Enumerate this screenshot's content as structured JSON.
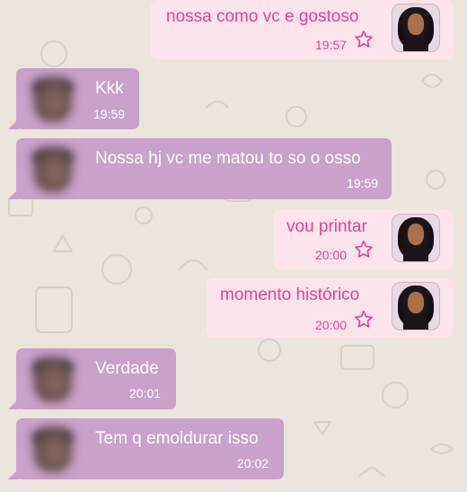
{
  "messages": [
    {
      "direction": "outgoing",
      "text": "nossa como vc e gostoso",
      "time": "19:57",
      "avatar_icon": "profile-photo-icon",
      "status_icon": "star-icon"
    },
    {
      "direction": "incoming",
      "text": "Kkk",
      "time": "19:59",
      "avatar_icon": "profile-photo-icon"
    },
    {
      "direction": "incoming",
      "text": "Nossa hj vc me matou to so o osso",
      "time": "19:59",
      "avatar_icon": "profile-photo-icon"
    },
    {
      "direction": "outgoing",
      "text": "vou printar",
      "time": "20:00",
      "avatar_icon": "profile-photo-icon",
      "status_icon": "star-icon"
    },
    {
      "direction": "outgoing",
      "text": "momento histórico",
      "time": "20:00",
      "avatar_icon": "profile-photo-icon",
      "status_icon": "star-icon"
    },
    {
      "direction": "incoming",
      "text": "Verdade",
      "time": "20:01",
      "avatar_icon": "profile-photo-icon"
    },
    {
      "direction": "incoming",
      "text": "Tem q emoldurar isso",
      "time": "20:02",
      "avatar_icon": "profile-photo-icon"
    }
  ],
  "colors": {
    "background": "#ece5dd",
    "incoming_bubble": "#c8a2c8",
    "outgoing_bubble": "#fce4ec",
    "outgoing_text": "#e83e97",
    "incoming_text": "#ffffff"
  }
}
